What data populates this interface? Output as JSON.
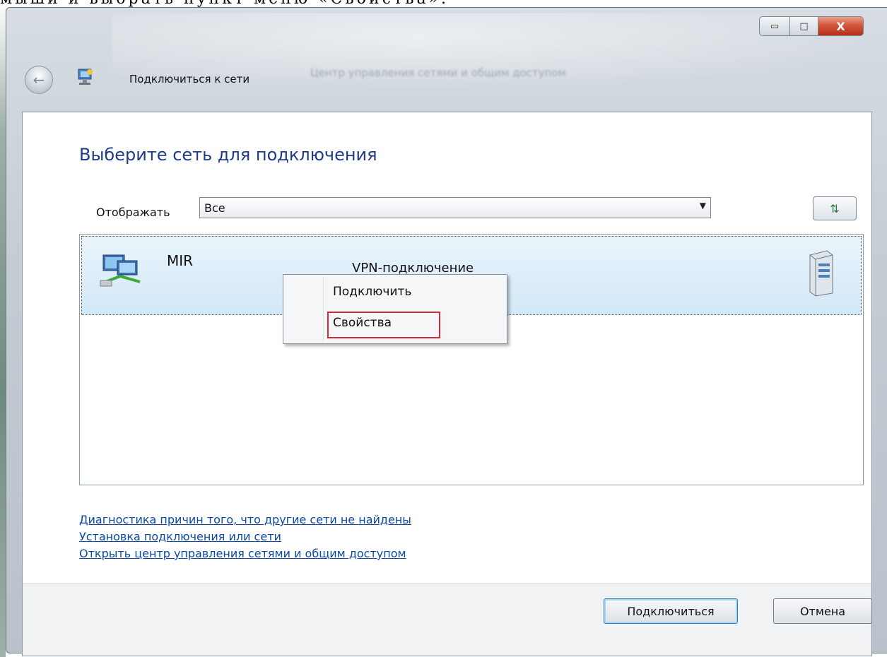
{
  "doc_text": "мыши и выбрать пункт меню «Свойства».",
  "window": {
    "title": "Подключиться к сети",
    "background_blur_text": "Центр управления сетями и общим доступом",
    "caption": {
      "minimize": "▭",
      "maximize": "□",
      "close": "X"
    }
  },
  "main": {
    "heading": "Выберите сеть для подключения",
    "show_label": "Отображать",
    "show_value": "Все",
    "networks": [
      {
        "name": "MIR",
        "type": "VPN-подключение"
      }
    ]
  },
  "context_menu": {
    "items": [
      "Подключить",
      "Свойства"
    ],
    "highlighted": "Свойства",
    "highlight_color": "#d42a3a"
  },
  "links": [
    "Диагностика причин того, что другие сети не найдены",
    "Установка подключения или сети",
    "Открыть центр управления сетями и общим доступом"
  ],
  "footer": {
    "connect_label": "Подключиться",
    "cancel_label": "Отмена"
  },
  "colors": {
    "heading": "#1e3a8c",
    "link": "#0b4aa8",
    "selection": "#d2e8f7",
    "close_button": "#c13b20"
  },
  "icons": [
    "back-arrow-icon",
    "network-connection-icon",
    "refresh-icon",
    "vpn-connection-icon",
    "server-icon",
    "dropdown-arrow-icon"
  ]
}
